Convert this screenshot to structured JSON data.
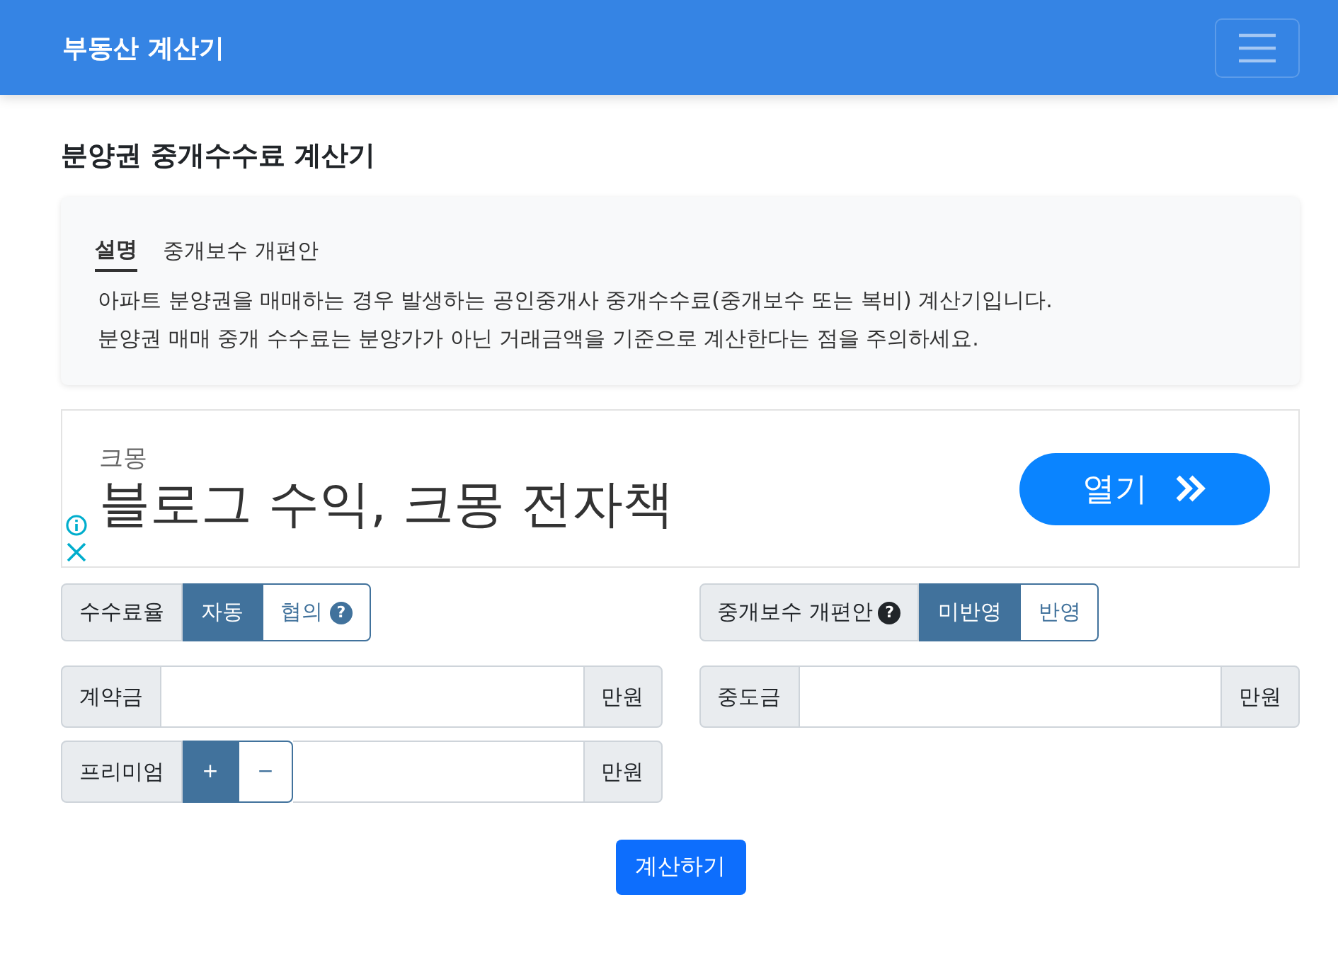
{
  "navbar": {
    "brand": "부동산 계산기"
  },
  "title": "분양권 중개수수료 계산기",
  "info": {
    "tabs": [
      {
        "label": "설명",
        "selected": true
      },
      {
        "label": "중개보수 개편안",
        "selected": false
      }
    ],
    "lines": [
      "아파트 분양권을 매매하는 경우 발생하는 공인중개사 중개수수료(중개보수 또는 복비) 계산기입니다.",
      "분양권 매매 중개 수수료는 분양가가 아닌 거래금액을 기준으로 계산한다는 점을 주의하세요."
    ]
  },
  "ad": {
    "advertiser": "크몽",
    "headline": "블로그 수익, 크몽 전자책",
    "button": "열기"
  },
  "options": [
    {
      "label": "수수료율",
      "choices": [
        {
          "label": "자동",
          "selected": true
        },
        {
          "label": "협의",
          "selected": false,
          "help": "?"
        }
      ]
    },
    {
      "label": "중개보수 개편안",
      "help": "?",
      "choices": [
        {
          "label": "미반영",
          "selected": true
        },
        {
          "label": "반영",
          "selected": false
        }
      ]
    }
  ],
  "fields": [
    {
      "label": "계약금",
      "unit": "만원"
    },
    {
      "label": "중도금",
      "unit": "만원"
    },
    {
      "label": "프리미엄",
      "unit": "만원",
      "signs": [
        {
          "label": "+",
          "selected": true
        },
        {
          "label": "−",
          "selected": false
        }
      ]
    }
  ],
  "submit": "계산하기"
}
